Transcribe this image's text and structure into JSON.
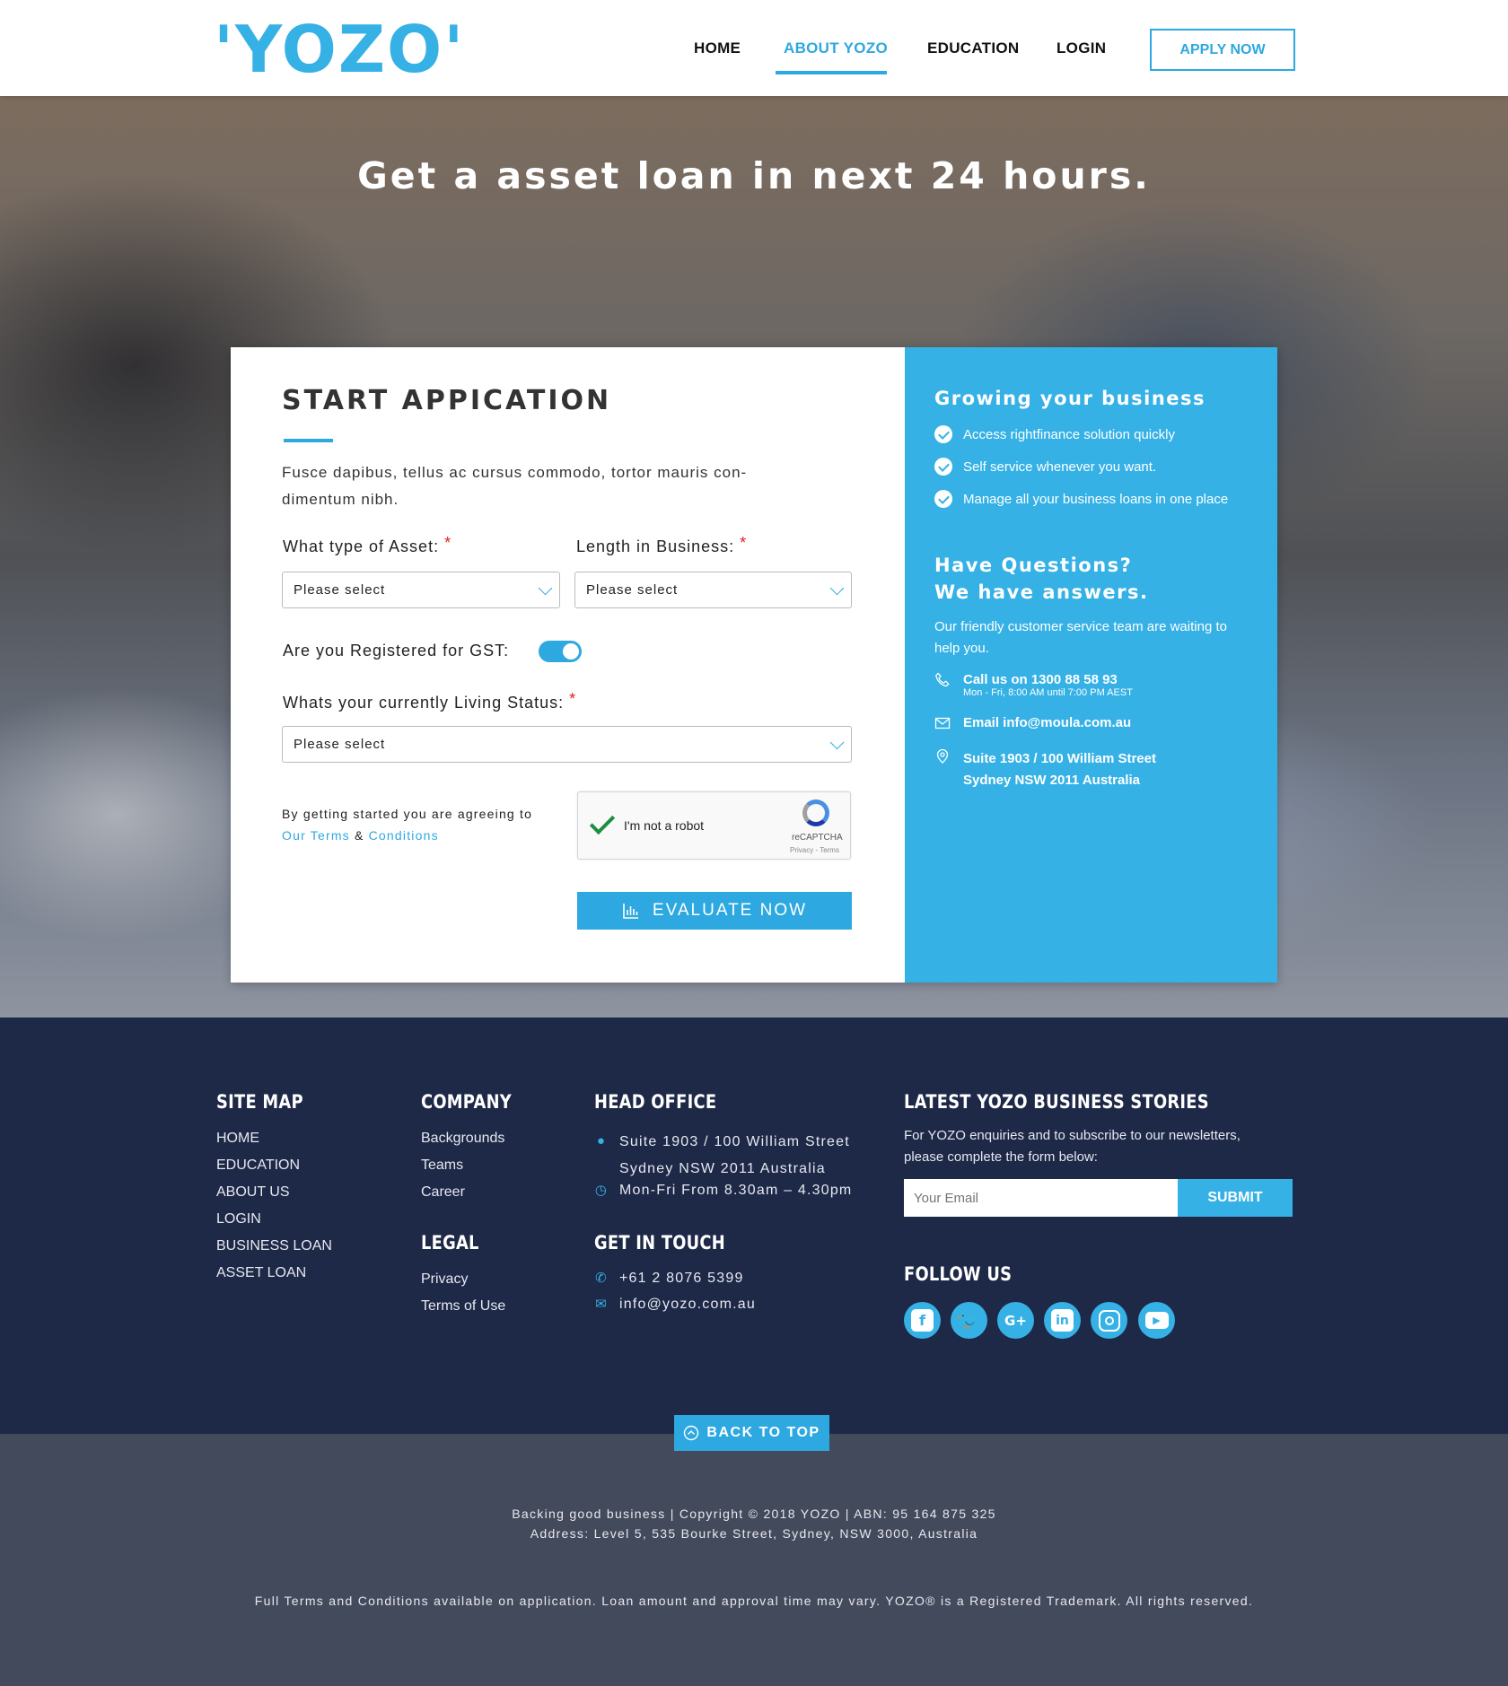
{
  "header": {
    "logo": "'YOZO'",
    "nav": [
      "HOME",
      "ABOUT YOZO",
      "EDUCATION",
      "LOGIN"
    ],
    "active_nav": "ABOUT YOZO",
    "apply_label": "APPLY NOW"
  },
  "hero": {
    "title": "Get a asset loan in next 24 hours."
  },
  "form": {
    "title": "START APPICATION",
    "intro": "Fusce dapibus, tellus ac cursus commodo, tortor mauris con-dimentum nibh.",
    "asset_label": "What type of Asset:",
    "asset_value": "Please select",
    "length_label": "Length in Business:",
    "length_value": "Please select",
    "gst_label": "Are you Registered for GST:",
    "gst_on": true,
    "living_label": "Whats your currently Living Status:",
    "living_value": "Please select",
    "required_mark": "*",
    "agree_text": "By getting started you are agreeing to",
    "terms_link": "Our Terms",
    "amp": "&",
    "conditions_link": "Conditions",
    "captcha_label": "I'm not a robot",
    "captcha_brand": "reCAPTCHA",
    "captcha_terms": "Privacy - Terms",
    "evaluate_label": "EVALUATE NOW"
  },
  "side": {
    "heading1": "Growing your business",
    "benefits": [
      "Access rightfinance solution quickly",
      "Self service whenever you want.",
      "Manage all your business loans in one place"
    ],
    "heading2_line1": "Have Questions?",
    "heading2_line2": "We have answers.",
    "desc": "Our friendly customer service team are waiting to help you.",
    "call": "Call us on 1300 88 58 93",
    "call_hours": "Mon - Fri, 8:00 AM until 7:00 PM AEST",
    "email": "Email info@moula.com.au",
    "address1": "Suite 1903 / 100 William Street",
    "address2": "Sydney NSW 2011 Australia"
  },
  "footer": {
    "sitemap_title": "SITE MAP",
    "sitemap": [
      "HOME",
      "EDUCATION",
      "ABOUT US",
      "LOGIN",
      "BUSINESS LOAN",
      "ASSET LOAN"
    ],
    "company_title": "COMPANY",
    "company": [
      "Backgrounds",
      "Teams",
      "Career"
    ],
    "legal_title": "LEGAL",
    "legal": [
      "Privacy",
      "Terms of Use"
    ],
    "office_title": "HEAD OFFICE",
    "office_address1": "Suite 1903 / 100 William Street",
    "office_address2": "Sydney NSW 2011 Australia",
    "office_hours": "Mon-Fri From 8.30am – 4.30pm",
    "touch_title": "GET IN TOUCH",
    "phone": "+61 2 8076 5399",
    "email": "info@yozo.com.au",
    "news_title": "LATEST YOZO BUSINESS STORIES",
    "news_desc": "For YOZO enquiries and to subscribe to our newsletters, please complete the form below:",
    "email_placeholder": "Your Email",
    "submit_label": "SUBMIT",
    "follow_title": "FOLLOW US",
    "social": [
      "facebook-icon",
      "twitter-icon",
      "google-plus-icon",
      "linkedin-icon",
      "instagram-icon",
      "youtube-icon"
    ]
  },
  "bottom": {
    "back_to_top": "BACK TO TOP",
    "copyright": "Backing good business | Copyright © 2018 YOZO | ABN: 95 164 875 325",
    "address": "Address: Level 5, 535 Bourke Street, Sydney, NSW 3000, Australia",
    "disclaimer": "Full Terms and Conditions available on application. Loan amount and approval time may vary. YOZO® is a Registered Trademark. All rights reserved."
  },
  "colors": {
    "accent": "#2ea8e0",
    "side_panel": "#35b1e6",
    "footer": "#1e2847",
    "bottom_bar": "#434a5c"
  }
}
